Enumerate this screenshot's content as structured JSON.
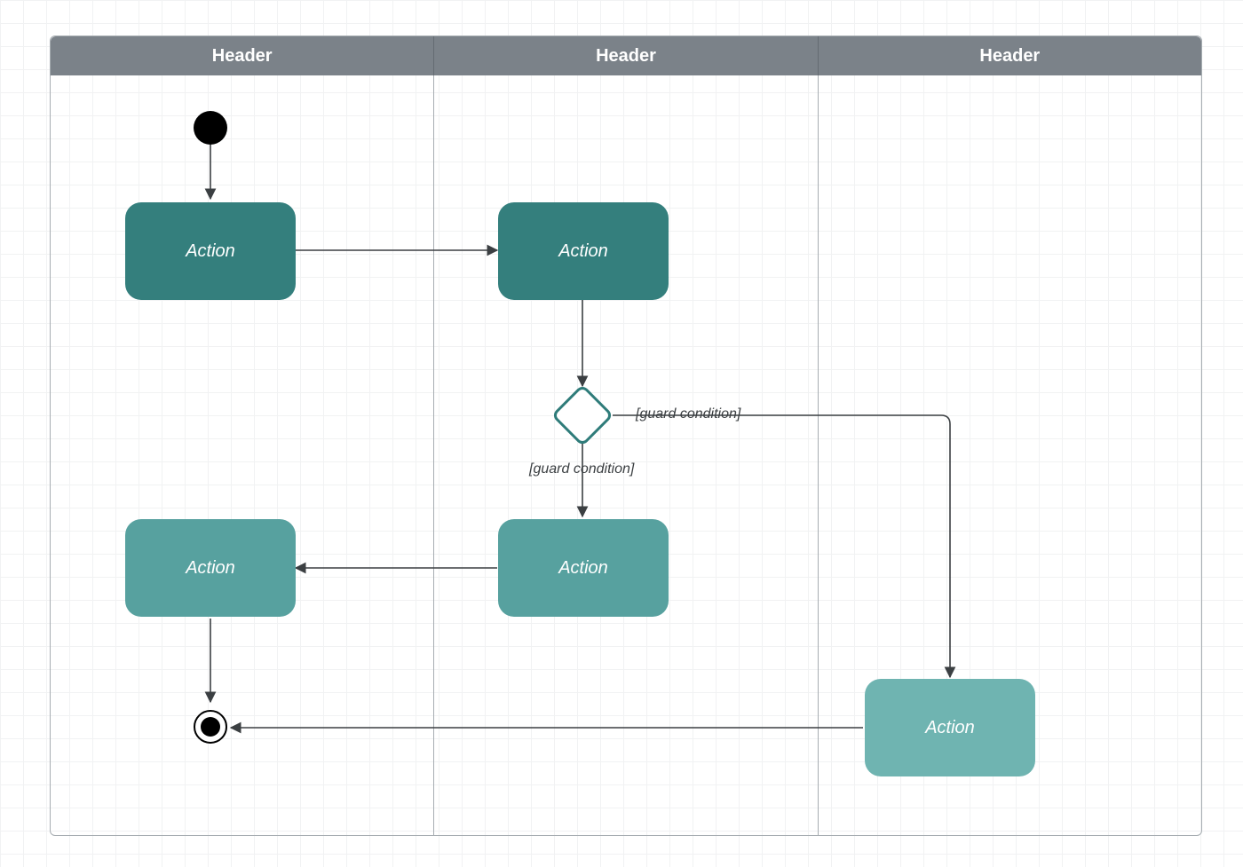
{
  "diagram": {
    "type": "uml-activity-swimlane",
    "lanes": [
      {
        "header": "Header"
      },
      {
        "header": "Header"
      },
      {
        "header": "Header"
      }
    ],
    "nodes": {
      "start": {
        "kind": "initial"
      },
      "a1": {
        "kind": "action",
        "label": "Action",
        "tone": "dark"
      },
      "a2": {
        "kind": "action",
        "label": "Action",
        "tone": "dark"
      },
      "d1": {
        "kind": "decision"
      },
      "a3": {
        "kind": "action",
        "label": "Action",
        "tone": "med"
      },
      "a4": {
        "kind": "action",
        "label": "Action",
        "tone": "med"
      },
      "a5": {
        "kind": "action",
        "label": "Action",
        "tone": "light"
      },
      "end": {
        "kind": "final"
      }
    },
    "edges": [
      {
        "from": "start",
        "to": "a1"
      },
      {
        "from": "a1",
        "to": "a2"
      },
      {
        "from": "a2",
        "to": "d1"
      },
      {
        "from": "d1",
        "to": "a3",
        "guard": "[guard condition]"
      },
      {
        "from": "d1",
        "to": "a5",
        "guard": "[guard condition]"
      },
      {
        "from": "a3",
        "to": "a4"
      },
      {
        "from": "a4",
        "to": "end"
      },
      {
        "from": "a5",
        "to": "end"
      }
    ]
  }
}
